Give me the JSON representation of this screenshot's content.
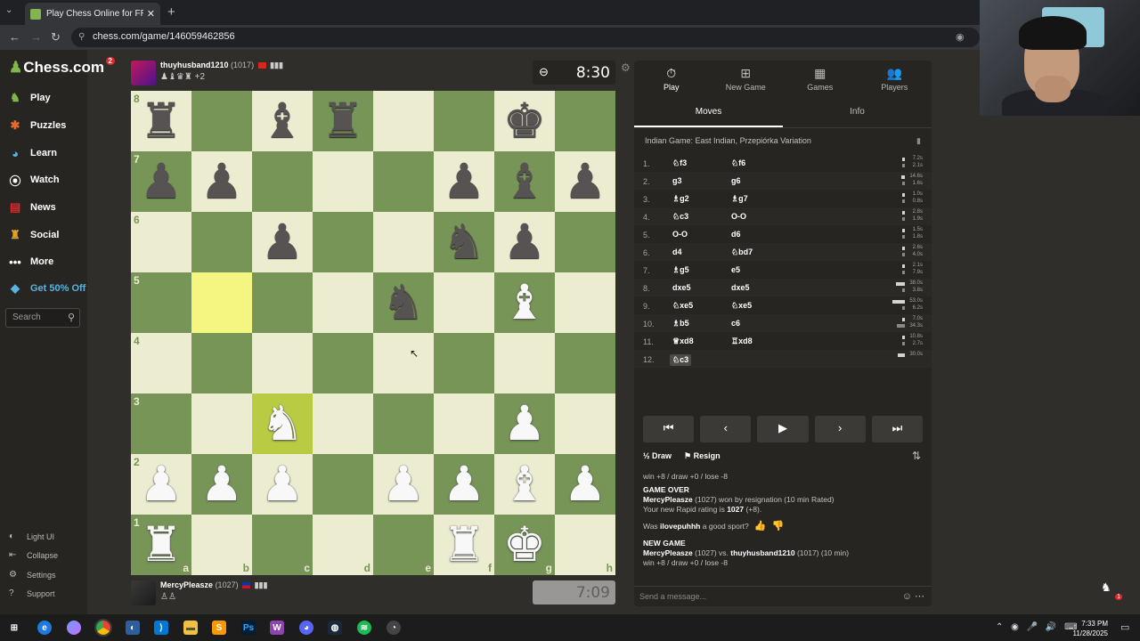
{
  "browser": {
    "tab_title": "Play Chess Online for FREE - 2 P",
    "url": "chess.com/game/146059462856"
  },
  "sidebar": {
    "logo": "Chess.com",
    "logo_badge": "2",
    "items": [
      {
        "label": "Play",
        "icon": "play-icon"
      },
      {
        "label": "Puzzles",
        "icon": "puzzle-icon"
      },
      {
        "label": "Learn",
        "icon": "learn-icon"
      },
      {
        "label": "Watch",
        "icon": "watch-icon"
      },
      {
        "label": "News",
        "icon": "news-icon"
      },
      {
        "label": "Social",
        "icon": "social-icon"
      },
      {
        "label": "More",
        "icon": "more-icon"
      }
    ],
    "promo": "Get 50% Off",
    "search_placeholder": "Search",
    "bottom": [
      {
        "label": "Light UI",
        "icon": "light-ui-icon"
      },
      {
        "label": "Collapse",
        "icon": "collapse-icon"
      },
      {
        "label": "Settings",
        "icon": "gear-icon"
      },
      {
        "label": "Support",
        "icon": "help-icon"
      }
    ]
  },
  "top_player": {
    "name": "thuyhusband1210",
    "rating": "(1017)",
    "captured": "♟♝♛♜ +2",
    "clock": "8:30"
  },
  "bottom_player": {
    "name": "MercyPleasze",
    "rating": "(1027)",
    "captured": "♙♙",
    "clock": "7:09"
  },
  "board": {
    "rows": [
      [
        "br",
        "",
        "bb",
        "br",
        "",
        "",
        "bk",
        ""
      ],
      [
        "bp",
        "bp",
        "",
        "",
        "",
        "bp",
        "bb",
        "bp"
      ],
      [
        "",
        "",
        "bp",
        "",
        "",
        "bn",
        "bp",
        ""
      ],
      [
        "",
        "",
        "",
        "",
        "bn",
        "",
        "wb",
        ""
      ],
      [
        "",
        "",
        "",
        "",
        "",
        "",
        "",
        ""
      ],
      [
        "",
        "",
        "wn",
        "",
        "",
        "",
        "wp",
        ""
      ],
      [
        "wp",
        "wp",
        "wp",
        "",
        "wp",
        "wp",
        "wb",
        "wp"
      ],
      [
        "wr",
        "",
        "",
        "",
        "",
        "wr",
        "wk",
        ""
      ]
    ],
    "highlights": [
      "b5",
      "c3"
    ],
    "ranks": [
      "8",
      "7",
      "6",
      "5",
      "4",
      "3",
      "2",
      "1"
    ],
    "files": [
      "a",
      "b",
      "c",
      "d",
      "e",
      "f",
      "g",
      "h"
    ]
  },
  "panel": {
    "nav": [
      {
        "label": "Play",
        "icon": "timer-icon"
      },
      {
        "label": "New Game",
        "icon": "plus-icon"
      },
      {
        "label": "Games",
        "icon": "board-icon"
      },
      {
        "label": "Players",
        "icon": "players-icon"
      }
    ],
    "tabs": [
      "Moves",
      "Info"
    ],
    "opening": "Indian Game: East Indian, Przepiórka Variation",
    "moves": [
      {
        "n": "1.",
        "w": "♘f3",
        "b": "♘f6",
        "tw": "7.2s",
        "tb": "2.1s",
        "fw": 0.04,
        "fb": 0.02
      },
      {
        "n": "2.",
        "w": "g3",
        "b": "g6",
        "tw": "14.6s",
        "tb": "1.6s",
        "fw": 0.1,
        "fb": 0.01
      },
      {
        "n": "3.",
        "w": "♗g2",
        "b": "♗g7",
        "tw": "1.0s",
        "tb": "0.8s",
        "fw": 0.01,
        "fb": 0.01
      },
      {
        "n": "4.",
        "w": "♘c3",
        "b": "O-O",
        "tw": "2.8s",
        "tb": "1.9s",
        "fw": 0.02,
        "fb": 0.01
      },
      {
        "n": "5.",
        "w": "O-O",
        "b": "d6",
        "tw": "1.5s",
        "tb": "1.8s",
        "fw": 0.01,
        "fb": 0.01
      },
      {
        "n": "6.",
        "w": "d4",
        "b": "♘bd7",
        "tw": "2.6s",
        "tb": "4.0s",
        "fw": 0.02,
        "fb": 0.03
      },
      {
        "n": "7.",
        "w": "♗g5",
        "b": "e5",
        "tw": "2.1s",
        "tb": "7.9s",
        "fw": 0.01,
        "fb": 0.05
      },
      {
        "n": "8.",
        "w": "dxe5",
        "b": "dxe5",
        "tw": "38.0s",
        "tb": "3.8s",
        "fw": 0.25,
        "fb": 0.02
      },
      {
        "n": "9.",
        "w": "♘xe5",
        "b": "♘xe5",
        "tw": "53.0s",
        "tb": "6.2s",
        "fw": 0.35,
        "fb": 0.04
      },
      {
        "n": "10.",
        "w": "♗b5",
        "b": "c6",
        "tw": "7.0s",
        "tb": "34.3s",
        "fw": 0.04,
        "fb": 0.22
      },
      {
        "n": "11.",
        "w": "♕xd8",
        "b": "♖xd8",
        "tw": "10.8s",
        "tb": "2.7s",
        "fw": 0.07,
        "fb": 0.02
      },
      {
        "n": "12.",
        "w": "♘c3",
        "b": "",
        "tw": "30.0s",
        "tb": "",
        "fw": 0.2,
        "fb": 0
      }
    ],
    "controls": [
      "⏮",
      "‹",
      "▶",
      "›",
      "⏭"
    ],
    "draw_label": "Draw",
    "resign_label": "Resign",
    "chat": {
      "line0": "win +8 / draw +0 / lose -8",
      "game_over": "GAME OVER",
      "result_name": "MercyPleasze",
      "result_rest": " (1027) won by resignation (10 min Rated)",
      "rating_line_pre": "Your new Rapid rating is ",
      "rating_value": "1027",
      "rating_line_post": " (+8).",
      "sport_pre": "Was ",
      "sport_name": "ilovepuhhh",
      "sport_post": " a good sport?",
      "new_game": "NEW GAME",
      "ng_name1": "MercyPleasze",
      "ng_mid": " (1027) vs. ",
      "ng_name2": "thuyhusband1210",
      "ng_post": " (1017) (10 min)",
      "line_last": "win +8 / draw +0 / lose -8"
    },
    "message_placeholder": "Send a message..."
  },
  "taskbar": {
    "time": "7:33 PM",
    "date": "11/28/2025"
  },
  "overlay_badge": "1"
}
